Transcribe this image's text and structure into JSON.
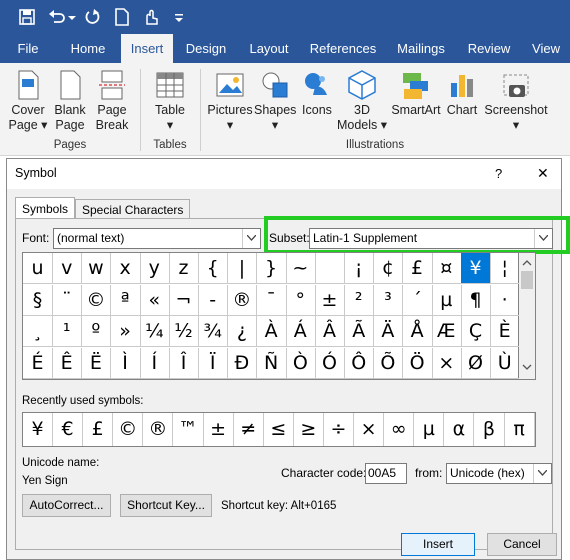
{
  "quick_access": {
    "icons": [
      "save-icon",
      "undo-icon",
      "redo-icon",
      "new-document-icon",
      "touch-mode-icon",
      "customize-icon"
    ]
  },
  "tabs": [
    "File",
    "Home",
    "Insert",
    "Design",
    "Layout",
    "References",
    "Mailings",
    "Review",
    "View"
  ],
  "ribbon": {
    "buttons": [
      {
        "line1": "Cover",
        "line2": "Page ▾"
      },
      {
        "line1": "Blank",
        "line2": "Page"
      },
      {
        "line1": "Page",
        "line2": "Break"
      },
      {
        "line1": "Table",
        "line2": "▾"
      },
      {
        "line1": "Pictures",
        "line2": "▾"
      },
      {
        "line1": "Shapes",
        "line2": "▾"
      },
      {
        "line1": "Icons",
        "line2": ""
      },
      {
        "line1": "3D",
        "line2": "Models ▾"
      },
      {
        "line1": "SmartArt",
        "line2": ""
      },
      {
        "line1": "Chart",
        "line2": ""
      },
      {
        "line1": "Screenshot",
        "line2": "▾"
      }
    ],
    "groups": [
      "Pages",
      "Tables",
      "Illustrations"
    ]
  },
  "dialog": {
    "title": "Symbol",
    "help": "?",
    "close": "✕",
    "tab_symbols": "Symbols",
    "tab_special": "Special Characters",
    "font_label": "Font:",
    "font_value": "(normal text)",
    "subset_label": "Subset:",
    "subset_value": "Latin-1 Supplement",
    "highlight_color": "#22cc22",
    "selected_color": "#0078d7",
    "grid": [
      [
        "u",
        "v",
        "w",
        "x",
        "y",
        "z",
        "{",
        "|",
        "}",
        "~",
        "",
        "¡",
        "¢",
        "£",
        "¤",
        "¥",
        "¦"
      ],
      [
        "§",
        "¨",
        "©",
        "ª",
        "«",
        "¬",
        "-",
        "®",
        "¯",
        "°",
        "±",
        "²",
        "³",
        "´",
        "µ",
        "¶",
        "·"
      ],
      [
        "¸",
        "¹",
        "º",
        "»",
        "¼",
        "½",
        "¾",
        "¿",
        "À",
        "Á",
        "Â",
        "Ã",
        "Ä",
        "Å",
        "Æ",
        "Ç",
        "È"
      ],
      [
        "É",
        "Ê",
        "Ë",
        "Ì",
        "Í",
        "Î",
        "Ï",
        "Ð",
        "Ñ",
        "Ò",
        "Ó",
        "Ô",
        "Õ",
        "Ö",
        "×",
        "Ø",
        "Ù"
      ]
    ],
    "selected_symbol": "¥",
    "recent_label": "Recently used symbols:",
    "recent": [
      "¥",
      "€",
      "£",
      "©",
      "®",
      "™",
      "±",
      "≠",
      "≤",
      "≥",
      "÷",
      "×",
      "∞",
      "µ",
      "α",
      "β",
      "π"
    ],
    "unicode_name_label": "Unicode name:",
    "unicode_name": "Yen Sign",
    "char_code_label": "Character code:",
    "char_code": "00A5",
    "from_label": "from:",
    "from_value": "Unicode (hex)",
    "autocorrect": "AutoCorrect...",
    "shortcut_key_btn": "Shortcut Key...",
    "shortcut_text": "Shortcut key: Alt+0165",
    "insert": "Insert",
    "cancel": "Cancel"
  }
}
